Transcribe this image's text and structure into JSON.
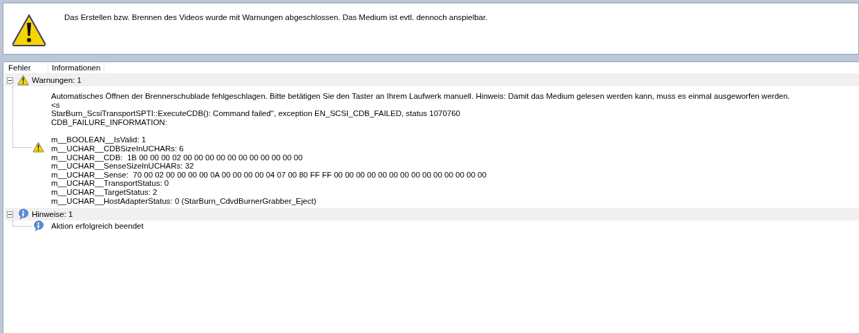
{
  "message": {
    "kind": "warning",
    "text": "Das Erstellen bzw. Brennen des Videos wurde mit Warnungen abgeschlossen. Das Medium ist evtl. dennoch anspielbar."
  },
  "columns": [
    "Fehler",
    "Informationen"
  ],
  "groups": [
    {
      "kind": "warning",
      "label": "Warnungen: 1",
      "expanded": true,
      "children": [
        {
          "kind": "warning",
          "blocks": [
            {
              "lines": [
                "Automatisches Öffnen der Brennerschublade fehlgeschlagen. Bitte betätigen Sie den Taster an Ihrem Laufwerk manuell. Hinweis: Damit das Medium gelesen werden kann, muss es einmal ausgeworfen werden.",
                "<s",
                "StarBurn_ScsiTransportSPTI::ExecuteCDB(): Command failed'', exception EN_SCSI_CDB_FAILED, status 1070760",
                "CDB_FAILURE_INFORMATION:"
              ]
            },
            {
              "lines": [
                "m__BOOLEAN__IsValid: 1",
                "m__UCHAR__CDBSizeInUCHARs: 6",
                "m__UCHAR__CDB:  1B 00 00 00 02 00 00 00 00 00 00 00 00 00 00 00",
                "m__UCHAR__SenseSizeInUCHARs: 32",
                "m__UCHAR__Sense:  70 00 02 00 00 00 00 0A 00 00 00 00 04 07 00 80 FF FF 00 00 00 00 00 00 00 00 00 00 00 00 00 00",
                "m__UCHAR__TransportStatus: 0",
                "m__UCHAR__TargetStatus: 2",
                "m__UCHAR__HostAdapterStatus: 0 (StarBurn_CdvdBurnerGrabber_Eject)"
              ]
            }
          ]
        }
      ]
    },
    {
      "kind": "info",
      "label": "Hinweise: 1",
      "expanded": true,
      "children": [
        {
          "kind": "info",
          "blocks": [
            {
              "lines": [
                "Aktion erfolgreich beendet"
              ]
            }
          ]
        }
      ]
    }
  ]
}
